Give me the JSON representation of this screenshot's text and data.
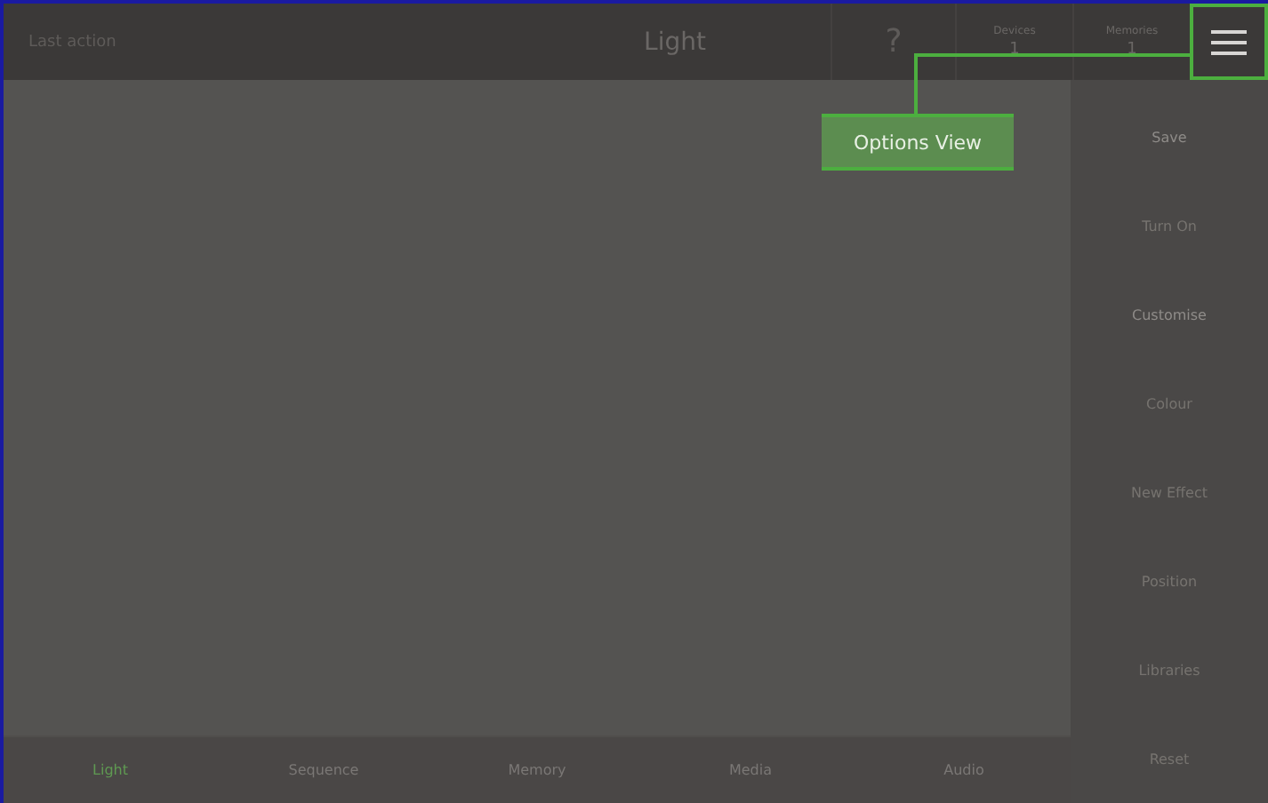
{
  "header": {
    "last_action": "Last action",
    "title": "Light",
    "help": "?",
    "counters": [
      {
        "label": "Devices",
        "value": "1"
      },
      {
        "label": "Memories",
        "value": "1"
      }
    ]
  },
  "callout": {
    "text": "Options View"
  },
  "side_actions": [
    {
      "label": "Save",
      "disabled": false
    },
    {
      "label": "Turn On",
      "disabled": true
    },
    {
      "label": "Customise",
      "disabled": false
    },
    {
      "label": "Colour",
      "disabled": true
    },
    {
      "label": "New Effect",
      "disabled": true
    },
    {
      "label": "Position",
      "disabled": true
    },
    {
      "label": "Libraries",
      "disabled": true
    },
    {
      "label": "Reset",
      "disabled": true
    }
  ],
  "tabs": [
    {
      "label": "Light",
      "selected": true
    },
    {
      "label": "Sequence",
      "selected": false
    },
    {
      "label": "Memory",
      "selected": false
    },
    {
      "label": "Media",
      "selected": false
    },
    {
      "label": "Audio",
      "selected": false
    }
  ]
}
